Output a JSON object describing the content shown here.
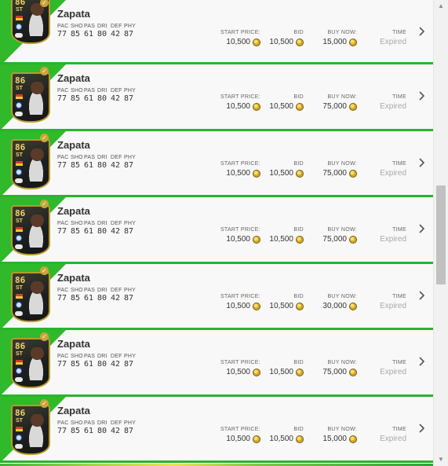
{
  "stat_labels": [
    "PAC",
    "SHO",
    "PAS",
    "DRI",
    "DEF",
    "PHY"
  ],
  "column_labels": {
    "start_price": "START PRICE:",
    "bid": "BID",
    "buy_now": "BUY NOW:",
    "time": "TIME"
  },
  "icons": {
    "chevron": "chevron-right-icon",
    "coin": "coin-icon",
    "check": "check-badge-icon"
  },
  "colors": {
    "accent_green": "#27b52c",
    "row_bg": "#f8f8f8",
    "expired_text": "#a8a8a8",
    "card_gold": "#b89a2c"
  },
  "scrollbar": {
    "up": "▲",
    "down": "▼"
  },
  "listings": [
    {
      "name": "Zapata",
      "rating": "86",
      "position": "ST",
      "stats": [
        "77",
        "85",
        "61",
        "80",
        "42",
        "87"
      ],
      "start_price": "10,500",
      "bid": "10,500",
      "buy_now": "15,000",
      "time": "Expired"
    },
    {
      "name": "Zapata",
      "rating": "86",
      "position": "ST",
      "stats": [
        "77",
        "85",
        "61",
        "80",
        "42",
        "87"
      ],
      "start_price": "10,500",
      "bid": "10,500",
      "buy_now": "75,000",
      "time": "Expired"
    },
    {
      "name": "Zapata",
      "rating": "86",
      "position": "ST",
      "stats": [
        "77",
        "85",
        "61",
        "80",
        "42",
        "87"
      ],
      "start_price": "10,500",
      "bid": "10,500",
      "buy_now": "75,000",
      "time": "Expired"
    },
    {
      "name": "Zapata",
      "rating": "86",
      "position": "ST",
      "stats": [
        "77",
        "85",
        "61",
        "80",
        "42",
        "87"
      ],
      "start_price": "10,500",
      "bid": "10,500",
      "buy_now": "75,000",
      "time": "Expired"
    },
    {
      "name": "Zapata",
      "rating": "86",
      "position": "ST",
      "stats": [
        "77",
        "85",
        "61",
        "80",
        "42",
        "87"
      ],
      "start_price": "10,500",
      "bid": "10,500",
      "buy_now": "30,000",
      "time": "Expired"
    },
    {
      "name": "Zapata",
      "rating": "86",
      "position": "ST",
      "stats": [
        "77",
        "85",
        "61",
        "80",
        "42",
        "87"
      ],
      "start_price": "10,500",
      "bid": "10,500",
      "buy_now": "75,000",
      "time": "Expired"
    },
    {
      "name": "Zapata",
      "rating": "86",
      "position": "ST",
      "stats": [
        "77",
        "85",
        "61",
        "80",
        "42",
        "87"
      ],
      "start_price": "10,500",
      "bid": "10,500",
      "buy_now": "15,000",
      "time": "Expired"
    }
  ]
}
